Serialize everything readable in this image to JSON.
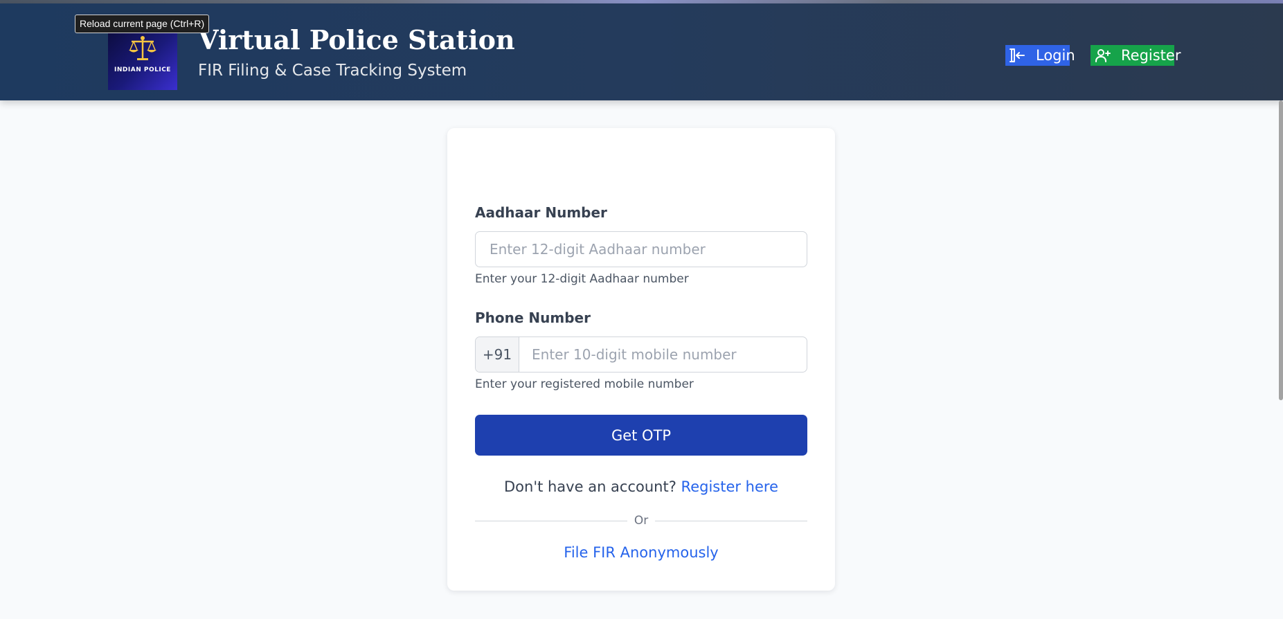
{
  "browser": {
    "tooltip": "Reload current page (Ctrl+R)"
  },
  "header": {
    "logo_text": "INDIAN POLICE",
    "title": "Virtual Police Station",
    "subtitle": "FIR Filing & Case Tracking System",
    "nav": {
      "login_label": "Login",
      "register_label": "Register"
    }
  },
  "form": {
    "aadhaar": {
      "label": "Aadhaar Number",
      "value": "",
      "placeholder": "Enter 12-digit Aadhaar number",
      "help": "Enter your 12-digit Aadhaar number"
    },
    "phone": {
      "label": "Phone Number",
      "prefix": "+91",
      "value": "",
      "placeholder": "Enter 10-digit mobile number",
      "help": "Enter your registered mobile number"
    },
    "submit_label": "Get OTP",
    "account_prompt": "Don't have an account?",
    "register_link": "Register here",
    "divider_text": "Or",
    "anonymous_link": "File FIR Anonymously"
  },
  "colors": {
    "header_bg": "#1e3a5f",
    "login_bg": "#2f63e6",
    "register_bg": "#16a34a",
    "primary_button": "#1e40af",
    "link": "#2563eb"
  }
}
